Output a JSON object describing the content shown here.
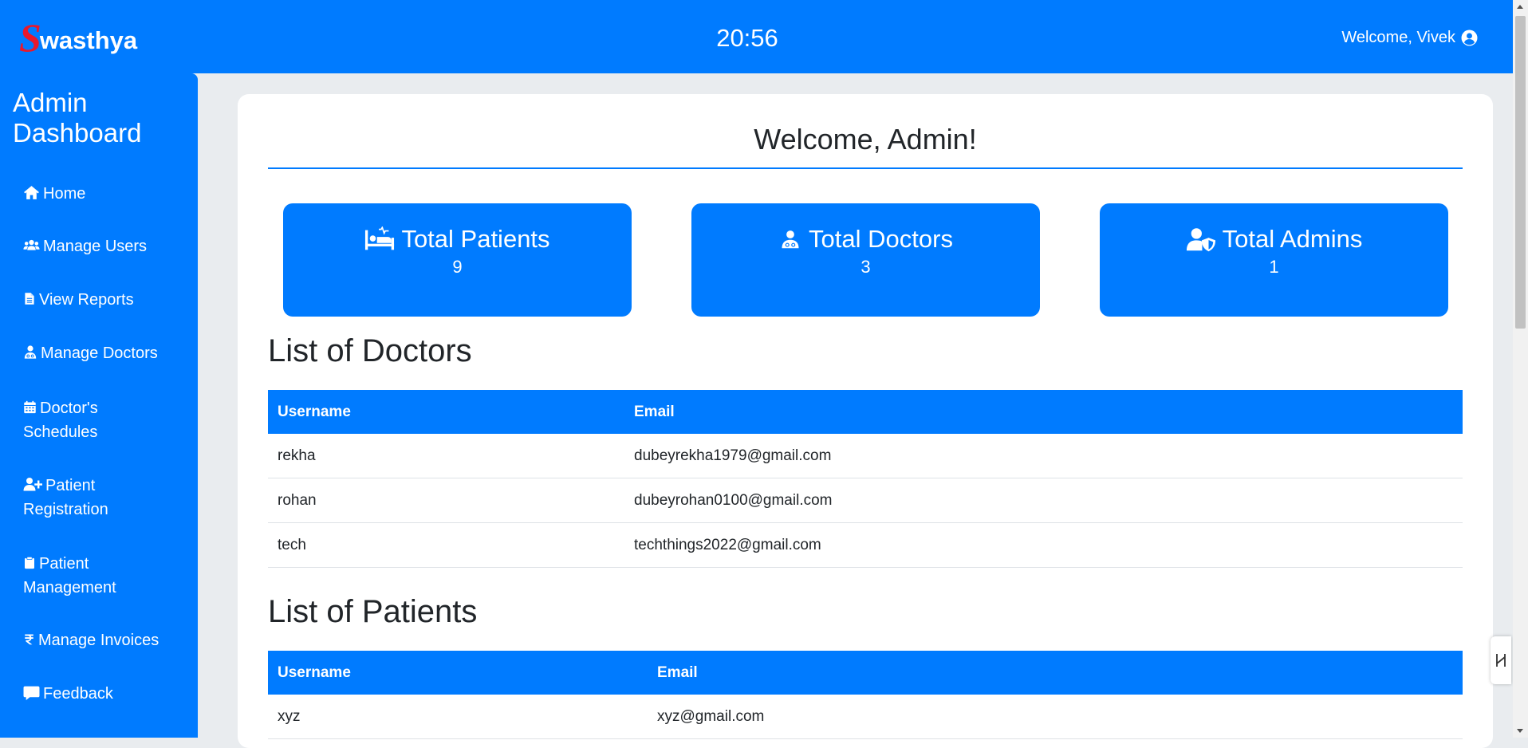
{
  "header": {
    "brand_initial": "S",
    "brand_rest": "wasthya",
    "clock": "20:56",
    "welcome": "Welcome, Vivek",
    "user_icon": "user-circle-icon"
  },
  "sidebar": {
    "title_line1": "Admin",
    "title_line2": "Dashboard",
    "items": [
      {
        "label": "Home",
        "icon": "home-icon"
      },
      {
        "label": "Manage Users",
        "icon": "users-icon"
      },
      {
        "label": "View Reports",
        "icon": "file-icon"
      },
      {
        "label": "Manage Doctors",
        "icon": "doctor-icon"
      },
      {
        "label_line1": "Doctor's",
        "label_line2": "Schedules",
        "icon": "calendar-icon"
      },
      {
        "label_line1": "Patient",
        "label_line2": "Registration",
        "icon": "user-plus-icon"
      },
      {
        "label_line1": "Patient",
        "label_line2": "Management",
        "icon": "clipboard-icon"
      },
      {
        "label": "Manage Invoices",
        "icon": "rupee-icon"
      },
      {
        "label": "Feedback",
        "icon": "comment-icon"
      }
    ]
  },
  "main": {
    "title": "Welcome, Admin!",
    "stats": [
      {
        "label": "Total Patients",
        "value": "9",
        "icon": "bed-icon"
      },
      {
        "label": "Total Doctors",
        "value": "3",
        "icon": "doctor-icon"
      },
      {
        "label": "Total Admins",
        "value": "1",
        "icon": "user-shield-icon"
      }
    ],
    "doctors": {
      "heading": "List of Doctors",
      "columns": [
        "Username",
        "Email"
      ],
      "rows": [
        [
          "rekha",
          "dubeyrekha1979@gmail.com"
        ],
        [
          "rohan",
          "dubeyrohan0100@gmail.com"
        ],
        [
          "tech",
          "techthings2022@gmail.com"
        ]
      ]
    },
    "patients": {
      "heading": "List of Patients",
      "columns": [
        "Username",
        "Email"
      ],
      "rows": [
        [
          "xyz",
          "xyz@gmail.com"
        ]
      ]
    }
  },
  "colors": {
    "primary": "#007bff",
    "brand_accent": "#e8192c",
    "page_background": "#e9ecef"
  }
}
